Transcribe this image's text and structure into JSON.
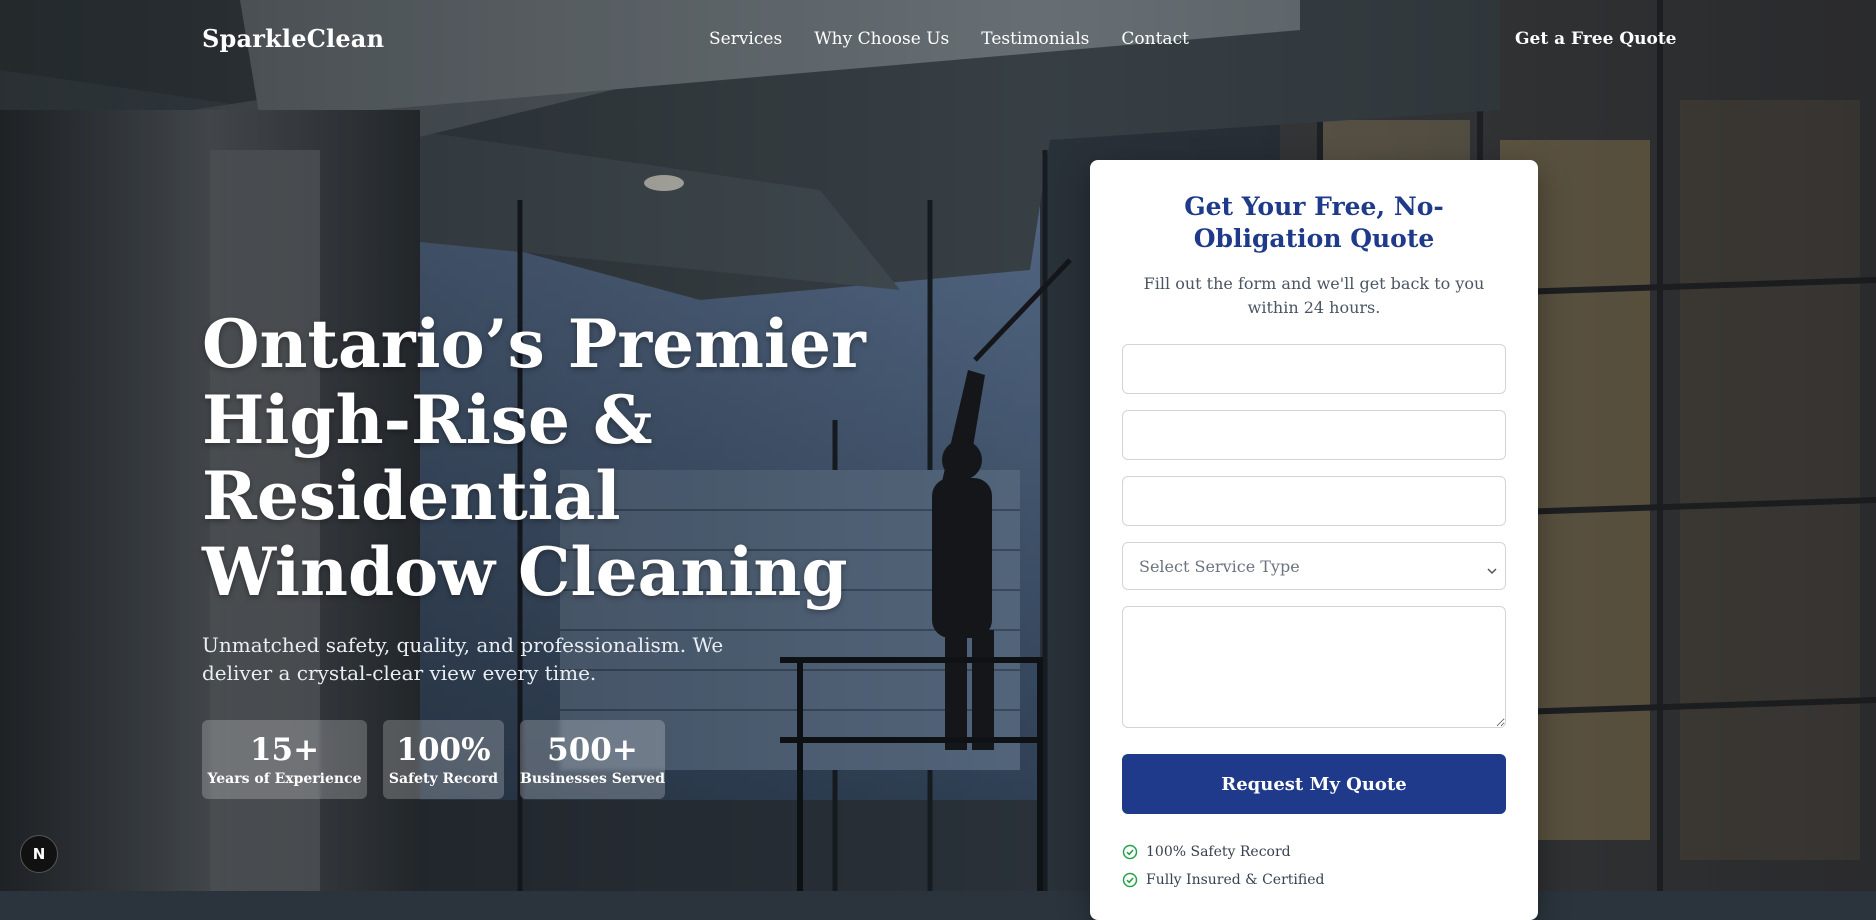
{
  "brand": {
    "name": "SparkleClean"
  },
  "nav": {
    "items": [
      {
        "label": "Services"
      },
      {
        "label": "Why Choose Us"
      },
      {
        "label": "Testimonials"
      },
      {
        "label": "Contact"
      }
    ],
    "cta": "Get a Free Quote"
  },
  "hero": {
    "title": "Ontario’s Premier High-Rise & Residential Window Cleaning",
    "subtitle": "Unmatched safety, quality, and professionalism. We deliver a crystal-clear view every time.",
    "stats": [
      {
        "value": "15+",
        "label": "Years of Experience"
      },
      {
        "value": "100%",
        "label": "Safety Record"
      },
      {
        "value": "500+",
        "label": "Businesses Served"
      }
    ]
  },
  "quote_form": {
    "title": "Get Your Free, No-Obligation Quote",
    "subtitle": "Fill out the form and we'll get back to you within 24 hours.",
    "name_value": "",
    "email_value": "",
    "phone_value": "",
    "service_selected": "Select Service Type",
    "message_value": "",
    "submit_label": "Request My Quote",
    "badges": [
      {
        "label": "100% Safety Record"
      },
      {
        "label": "Fully Insured & Certified"
      }
    ]
  },
  "badge": {
    "letter": "N"
  },
  "colors": {
    "primary": "#1f3a8a",
    "check": "#22a34a",
    "card_bg": "#ffffff"
  },
  "icons": {
    "check": "check-circle-icon",
    "select": "chevron-down-icon"
  }
}
